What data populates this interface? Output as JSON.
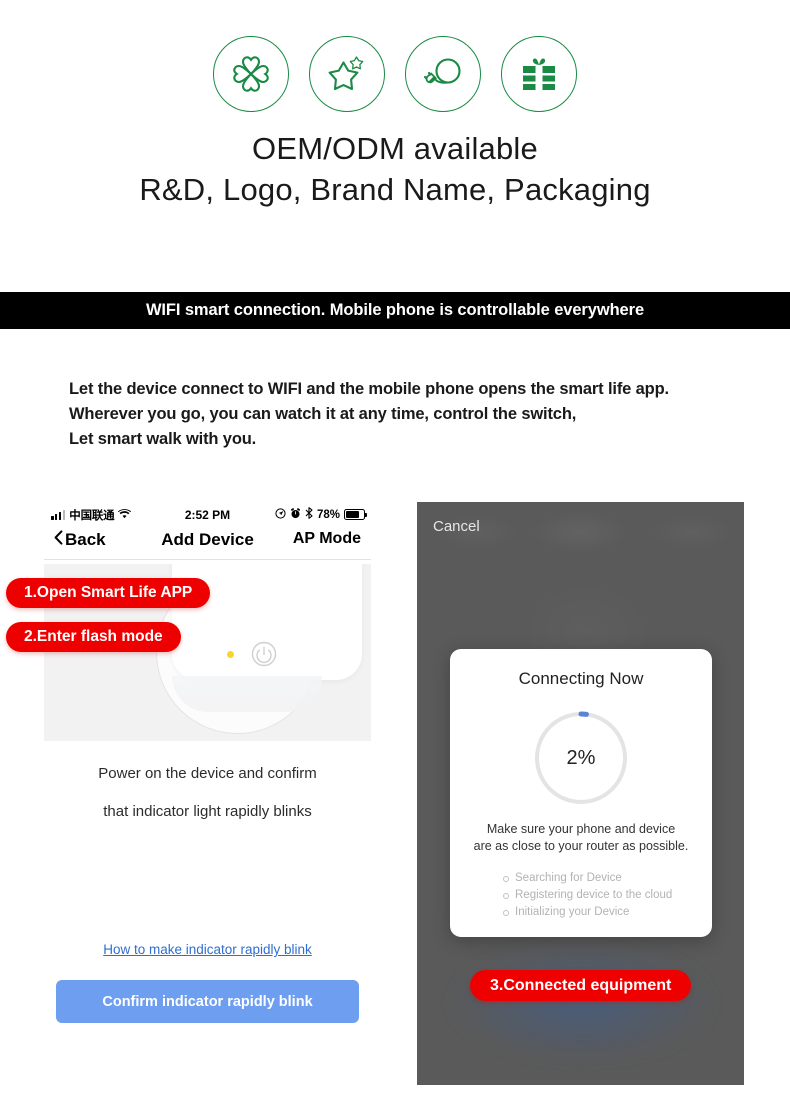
{
  "top": {
    "icons": [
      {
        "name": "clover-icon",
        "label": "four-leaf clover"
      },
      {
        "name": "star-icon",
        "label": "star"
      },
      {
        "name": "plug-cable-icon",
        "label": "plug with cable"
      },
      {
        "name": "gift-icon",
        "label": "gift box"
      }
    ],
    "title": "OEM/ODM available",
    "subtitle": "R&D, Logo, Brand Name, Packaging",
    "accent_color": "#1a8a45"
  },
  "banner": {
    "text": "WIFI smart connection. Mobile phone is controllable everywhere",
    "background": "#000000",
    "color": "#ffffff"
  },
  "intro": {
    "line1": "Let the device connect to WIFI and the mobile phone opens the smart life app.",
    "line2": "Wherever you go, you can watch it at any time, control the switch,",
    "line3": "Let smart walk with you."
  },
  "left_phone": {
    "status_bar": {
      "carrier": "中国联通",
      "time": "2:52 PM",
      "battery_percent": "78%",
      "battery_level": 78
    },
    "nav": {
      "back": "Back",
      "title": "Add Device",
      "right_action": "AP Mode"
    },
    "device_hint_line1": "Power on the device and confirm",
    "device_hint_line2": "that indicator light rapidly blinks",
    "help_link": "How to make indicator rapidly blink",
    "confirm_button": "Confirm indicator rapidly blink",
    "confirm_button_color": "#6d9ef0"
  },
  "right_phone": {
    "cancel": "Cancel",
    "modal": {
      "title": "Connecting Now",
      "percent": "2%",
      "progress_value": 2,
      "note_line1": "Make sure your phone and device",
      "note_line2": "are as close to your router as possible.",
      "steps": [
        "Searching for Device",
        "Registering device to the cloud",
        "Initializing your Device"
      ]
    }
  },
  "callouts": {
    "step1": "1.Open Smart Life APP",
    "step2": "2.Enter flash mode",
    "step3": "3.Connected equipment",
    "color": "#ee0000"
  }
}
